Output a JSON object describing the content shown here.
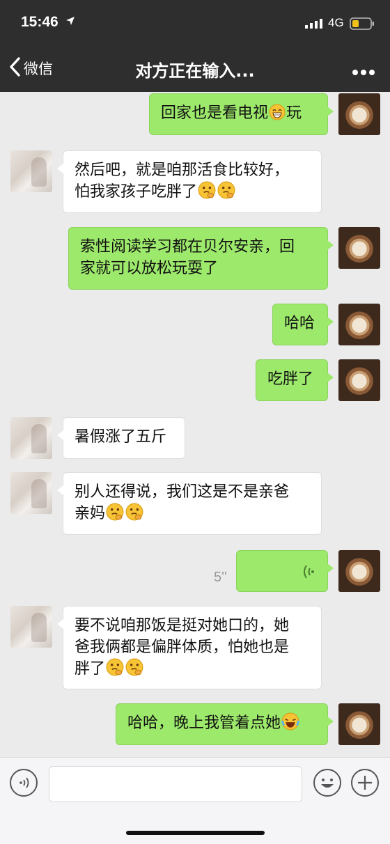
{
  "status_bar": {
    "time": "15:46",
    "network": "4G"
  },
  "nav": {
    "back_label": "微信",
    "title": "对方正在输入..."
  },
  "messages": {
    "m1": {
      "before": "回家也是看电视",
      "after": "玩"
    },
    "m2": {
      "line1": "然后吧，就是咱那活食比较好，",
      "line2": "怕我家孩子吃胖了"
    },
    "m3": {
      "line1": "索性阅读学习都在贝尔安亲，回",
      "line2": "家就可以放松玩耍了"
    },
    "m4": {
      "text": "哈哈"
    },
    "m5": {
      "text": "吃胖了"
    },
    "m6": {
      "text": "暑假涨了五斤"
    },
    "m7": {
      "line1": "别人还得说，我们这是不是亲爸",
      "line2": "亲妈"
    },
    "m8": {
      "duration": "5''"
    },
    "m9": {
      "line1": "要不说咱那饭是挺对她口的，她",
      "line2": "爸我俩都是偏胖体质，怕她也是",
      "line3": "胖了"
    },
    "m10": {
      "text": "哈哈，晚上我管着点她"
    }
  },
  "input_bar": {
    "placeholder": ""
  },
  "colors": {
    "my_bubble": "#9de96c",
    "other_bubble": "#ffffff",
    "chat_bg": "#ebebeb",
    "header_bg": "#2e2e2e"
  },
  "icons": [
    "location-arrow-icon",
    "signal-icon",
    "battery-icon",
    "chevron-left-icon",
    "more-dots-icon",
    "grin-emoji-icon",
    "hmm-emoji-icon",
    "laugh-cry-emoji-icon",
    "voice-wave-icon",
    "voice-input-icon",
    "emoji-icon",
    "plus-icon"
  ]
}
